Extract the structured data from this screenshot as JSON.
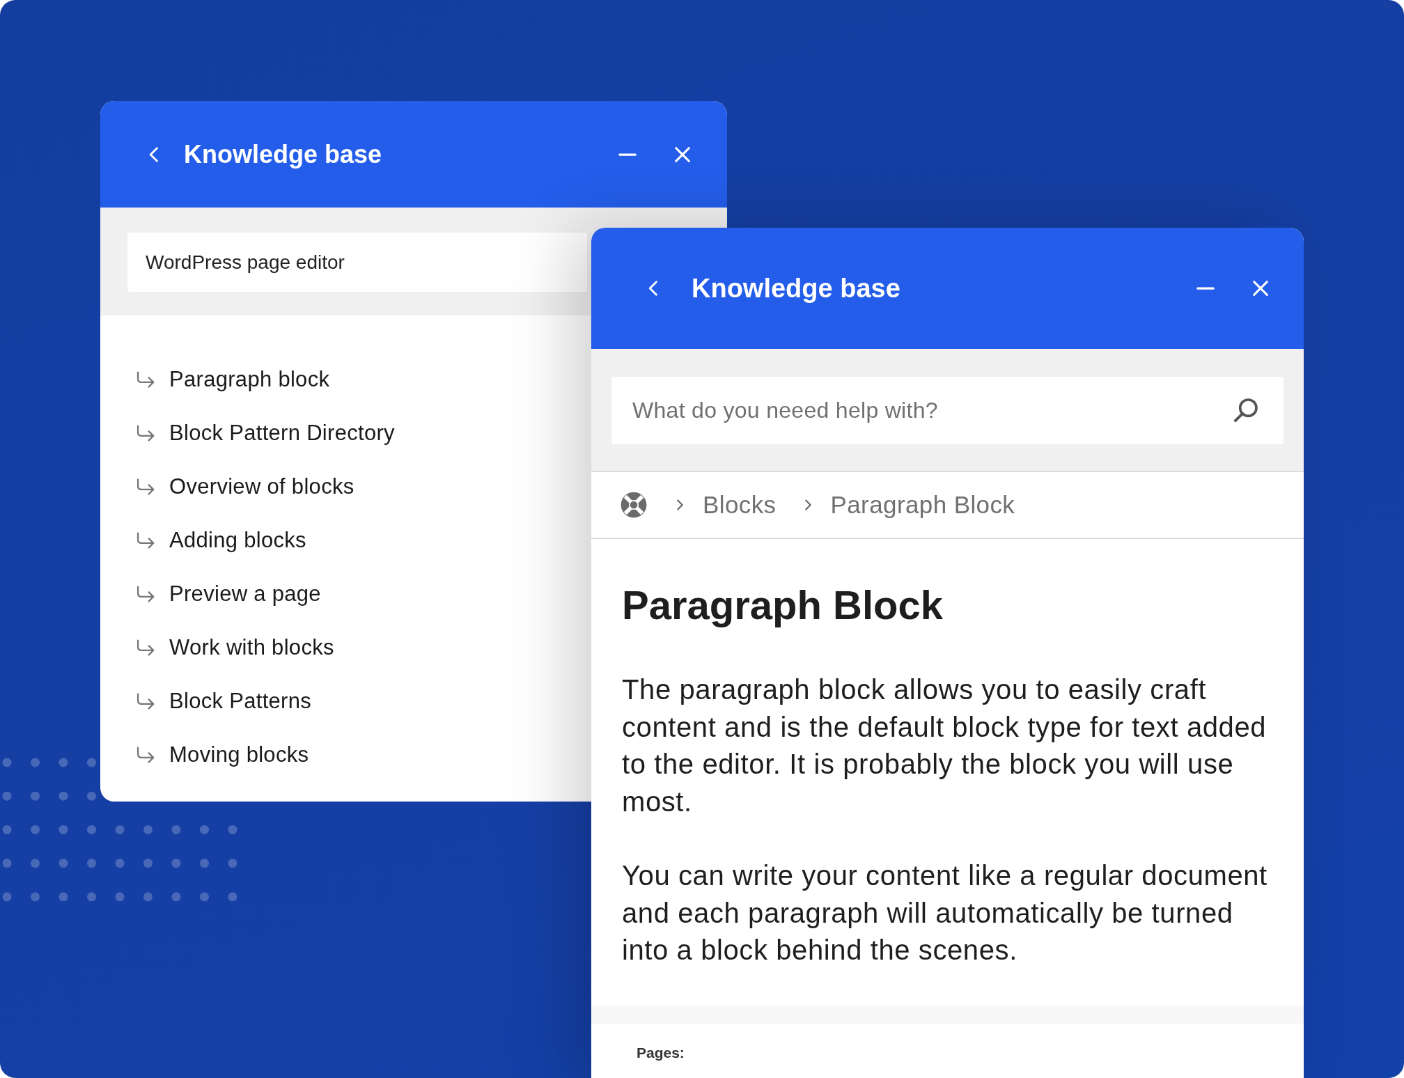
{
  "back_window": {
    "title": "Knowledge base",
    "search": {
      "value": "WordPress page editor"
    },
    "links": [
      "Paragraph block",
      "Block Pattern Directory",
      "Overview of blocks",
      "Adding blocks",
      "Preview a page",
      "Work with blocks",
      "Block Patterns",
      "Moving blocks"
    ]
  },
  "front_window": {
    "title": "Knowledge base",
    "search": {
      "placeholder": "What do you neeed help with?"
    },
    "breadcrumb": [
      "Blocks",
      "Paragraph Block"
    ],
    "article": {
      "heading": "Paragraph Block",
      "paragraphs": [
        "The paragraph block allows you to easily craft content and is the default block type for text added to the editor. It is probably the block you will use most.",
        "You can write your content like a regular document and each paragraph will automatically be turned into a block behind the scenes."
      ]
    },
    "footer_label": "Pages:"
  }
}
